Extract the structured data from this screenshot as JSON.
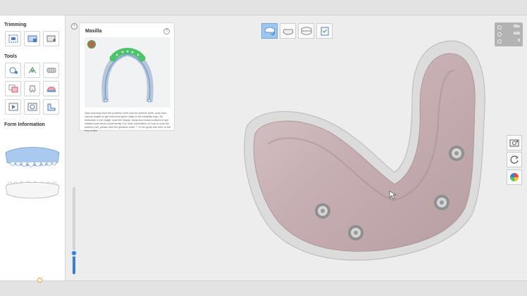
{
  "left_panel": {
    "trimming_label": "Trimming",
    "tools_label": "Tools",
    "form_info_label": "Form Information"
  },
  "guide": {
    "info_glyph": "i",
    "title": "Maxilla",
    "help_glyph": "?",
    "text": "Start scanning from the posterior teeth and for anterior teeth, scan from various angles to get maximum green data on the reliability map. As instructed in the image, scan the lingual, labial and incisal surfaces to get reliable scan result conveniently. For more information on how to scan the anterior part, please click the question mark '?' in the guide and refer to the help center."
  },
  "stats": {
    "time": "58s",
    "count": "928",
    "value": "0"
  },
  "colors": {
    "accent": "#3b7fd4",
    "active_tab": "#9ec7ef",
    "gingiva": "#c9b3b6",
    "reliability_green": "#4cc46a"
  },
  "icons": {
    "top_tabs": [
      "maxilla-scan-icon",
      "mandible-scan-icon",
      "occlusion-scan-icon",
      "checklist-icon"
    ],
    "right_tools": [
      "screenshot-camera-icon",
      "rotate-reset-icon",
      "reliability-map-icon"
    ]
  },
  "slider": {
    "level": 0.25
  }
}
